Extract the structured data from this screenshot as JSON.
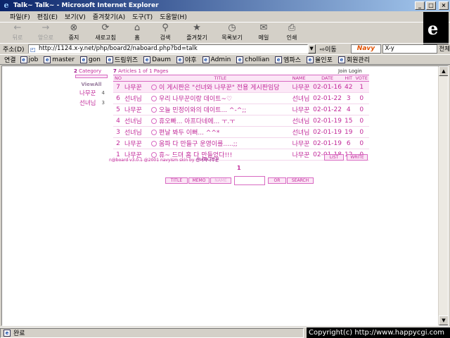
{
  "window": {
    "title": "Talk~ Talk~ - Microsoft Internet Explorer"
  },
  "menu": [
    "파일(F)",
    "편집(E)",
    "보기(V)",
    "즐겨찾기(A)",
    "도구(T)",
    "도움말(H)"
  ],
  "toolbar": [
    {
      "label": "뒤로",
      "icon": "←",
      "disabled": true
    },
    {
      "label": "앞으로",
      "icon": "→",
      "disabled": true
    },
    {
      "label": "중지",
      "icon": "⊗",
      "disabled": false
    },
    {
      "label": "새로고침",
      "icon": "⟳",
      "disabled": false
    },
    {
      "label": "홈",
      "icon": "⌂",
      "disabled": false
    },
    {
      "label": "검색",
      "icon": "⚲",
      "disabled": false
    },
    {
      "label": "즐겨찾기",
      "icon": "★",
      "disabled": false
    },
    {
      "label": "목록보기",
      "icon": "◷",
      "disabled": false
    },
    {
      "label": "메일",
      "icon": "✉",
      "disabled": false
    },
    {
      "label": "인쇄",
      "icon": "⎙",
      "disabled": false
    }
  ],
  "address": {
    "label": "주소(D)",
    "url": "http://1124.x-y.net/php/board2/naboard.php?bd=talk",
    "go_label": "이동",
    "navy_label": "Navy",
    "search_value": "X-y",
    "search_scope": "전체"
  },
  "links": {
    "label": "연결",
    "items": [
      "job",
      "master",
      "gon",
      "드림위즈",
      "Daum",
      "야후",
      "Admin",
      "chollian",
      "엠파스",
      "율인포",
      "회원관리"
    ]
  },
  "board": {
    "category_count": "2",
    "category_label": "Category",
    "articles_count": "7",
    "articles_label": "Articles 1 of 1 Pages",
    "join_login": "Join Login",
    "category_viewall": "ViewAll",
    "categories": [
      {
        "name": "나무꾼",
        "count": "4"
      },
      {
        "name": "선녀님",
        "count": "3"
      }
    ],
    "headers": {
      "no": "NO",
      "title": "TITLE",
      "name": "NAME",
      "date": "DATE",
      "hit": "HIT",
      "vote": "VOTE"
    },
    "rows": [
      {
        "no": "7",
        "cat": "나무꾼",
        "title": "이 게시판은 \"선녀와 나무꾼\" 전용 게시판임당",
        "author": "나무꾼",
        "date": "02-01-16",
        "hit": "42",
        "vote": "1",
        "selected": true
      },
      {
        "no": "6",
        "cat": "선녀님",
        "title": "우리 나무꾼이랑 데이트~♡",
        "author": "선녀님",
        "date": "02-01-22",
        "hit": "3",
        "vote": "0",
        "selected": false
      },
      {
        "no": "5",
        "cat": "나무꾼",
        "title": "오늘 민정이와의 데이트... ^-^;;",
        "author": "나무꾼",
        "date": "02-01-22",
        "hit": "4",
        "vote": "0",
        "selected": false
      },
      {
        "no": "4",
        "cat": "선녀님",
        "title": "휴오빠... 아프다네에... ㅜ.ㅜ",
        "author": "선녀님",
        "date": "02-01-19",
        "hit": "15",
        "vote": "0",
        "selected": false
      },
      {
        "no": "3",
        "cat": "선녀님",
        "title": "편날 봐두 이뻐... ^^*",
        "author": "선녀님",
        "date": "02-01-19",
        "hit": "19",
        "vote": "0",
        "selected": false
      },
      {
        "no": "2",
        "cat": "나무꾼",
        "title": "움파 다 만들구 운영이를.....;;",
        "author": "나무꾼",
        "date": "02-01-19",
        "hit": "6",
        "vote": "0",
        "selected": false
      },
      {
        "no": "1",
        "cat": "나무꾼",
        "title": "휴~ 드뎌 홈 다 만들었다!!!",
        "author": "나무꾼",
        "date": "02-01-18",
        "hit": "12",
        "vote": "0",
        "selected": false
      }
    ],
    "credit": "n@board v3.0.1 @2001 navyism skin by",
    "credit_author": "선녀와나무꾼",
    "list_button": "LIST",
    "write_button": "WRITE",
    "page_number": "1",
    "search_buttons": {
      "title": "TITLE",
      "memo": "MEMO",
      "name": "NAME",
      "or": "OR",
      "search": "SEARCH"
    }
  },
  "status": {
    "text": "완료"
  },
  "copyright": "Copyright(c) http://www.happycgi.com"
}
